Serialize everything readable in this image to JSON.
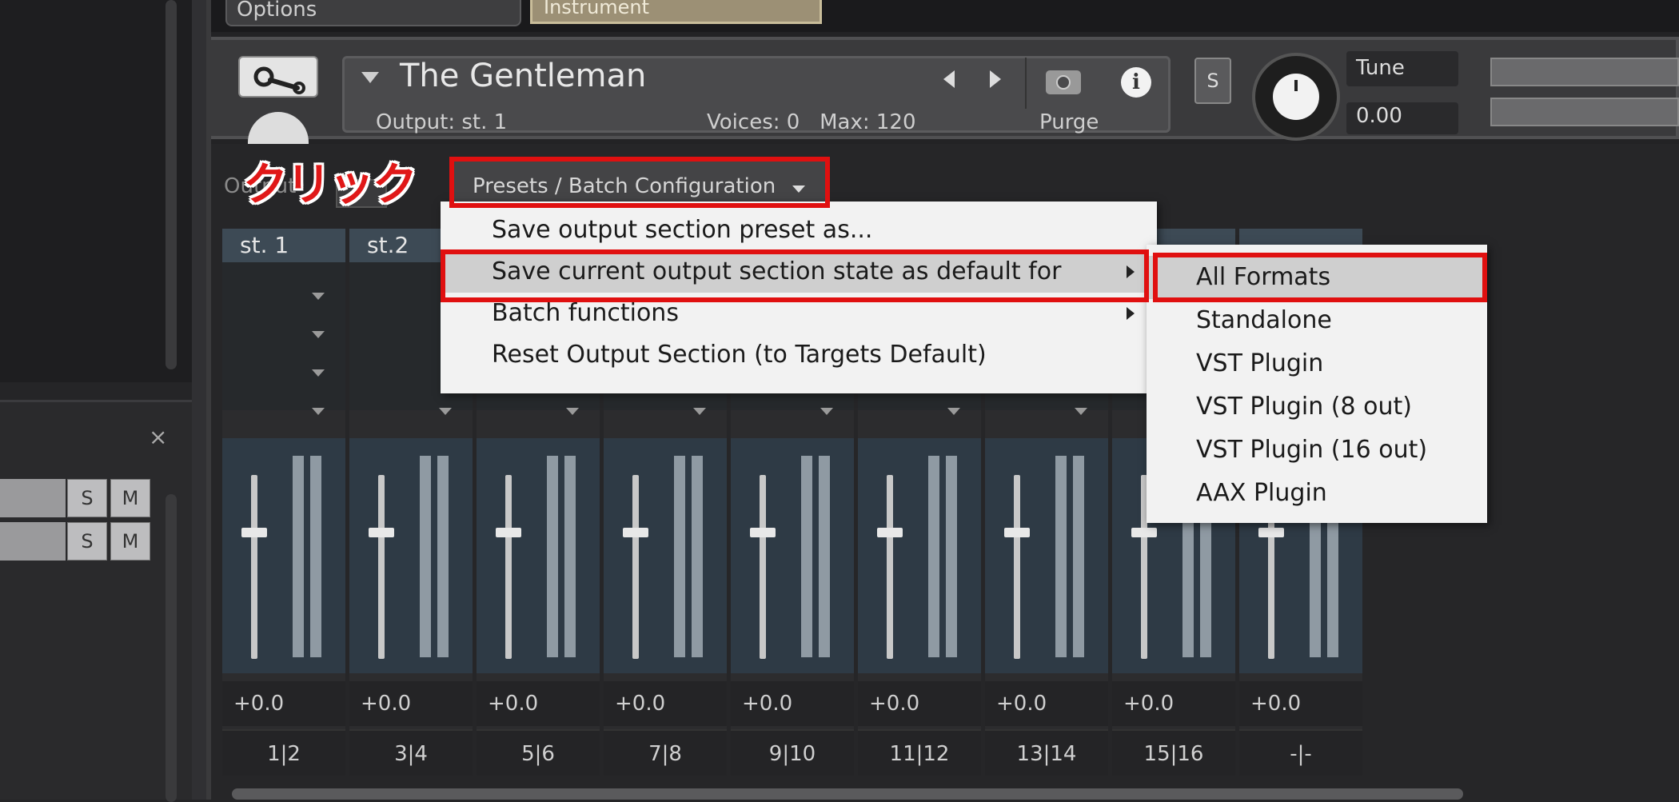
{
  "tabs": {
    "options": "Options",
    "instrument": "Instrument"
  },
  "instrument": {
    "name": "The Gentleman",
    "output_label": "Output:",
    "output_value": "st. 1",
    "voices_label": "Voices:",
    "voices_value": "0",
    "max_label": "Max:",
    "max_value": "120",
    "purge_label": "Purge",
    "solo_label": "S",
    "tune_label": "Tune",
    "tune_value": "0.00"
  },
  "output_section": {
    "label": "Output",
    "presets_button": "Presets / Batch Configuration",
    "channels": [
      {
        "name": "st. 1",
        "volume": "+0.0",
        "route": "1|2"
      },
      {
        "name": "st.2",
        "volume": "+0.0",
        "route": "3|4"
      },
      {
        "name": "",
        "volume": "+0.0",
        "route": "5|6"
      },
      {
        "name": "",
        "volume": "+0.0",
        "route": "7|8"
      },
      {
        "name": "",
        "volume": "+0.0",
        "route": "9|10"
      },
      {
        "name": "",
        "volume": "+0.0",
        "route": "11|12"
      },
      {
        "name": "",
        "volume": "+0.0",
        "route": "13|14"
      },
      {
        "name": "",
        "volume": "+0.0",
        "route": "15|16"
      },
      {
        "name": "",
        "volume": "+0.0",
        "route": "-|-"
      }
    ]
  },
  "host": {
    "close_label": "×",
    "tracks": [
      {
        "s": "S",
        "m": "M"
      },
      {
        "s": "S",
        "m": "M"
      }
    ]
  },
  "menu": {
    "items": [
      "Save output section preset as...",
      "Save current output section state as default for",
      "Batch functions",
      "Reset Output Section (to Targets Default)"
    ],
    "submenu": [
      "All Formats",
      "Standalone",
      "VST Plugin",
      "VST Plugin (8 out)",
      "VST Plugin (16 out)",
      "AAX Plugin"
    ]
  },
  "annotation": {
    "click_text": "クリック",
    "color": "#e01010"
  }
}
